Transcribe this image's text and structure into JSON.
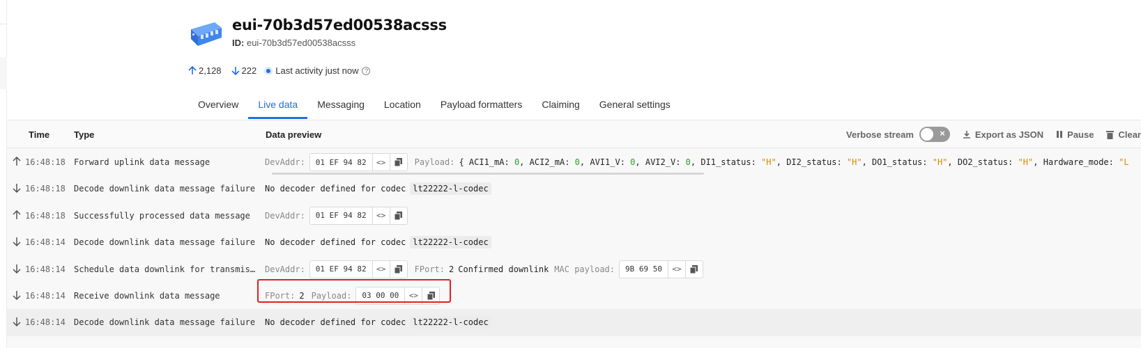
{
  "device": {
    "title": "eui-70b3d57ed00538acsss",
    "id_label": "ID:",
    "id_value": "eui-70b3d57ed00538acsss"
  },
  "stats": {
    "uplinks": "2,128",
    "downlinks": "222",
    "last_activity": "Last activity just now"
  },
  "tabs": [
    "Overview",
    "Live data",
    "Messaging",
    "Location",
    "Payload formatters",
    "Claiming",
    "General settings"
  ],
  "active_tab": "Live data",
  "table": {
    "col_time": "Time",
    "col_type": "Type",
    "col_preview": "Data preview",
    "verbose_label": "Verbose stream",
    "export_label": "Export as JSON",
    "pause_label": "Pause",
    "clear_label": "Clear"
  },
  "rows": [
    {
      "dir": "up",
      "time": "16:48:18",
      "type": "Forward uplink data message",
      "devaddr_label": "DevAddr:",
      "devaddr": "01 EF 94 82",
      "payload_label": "Payload:",
      "payload_fields": [
        {
          "k": "ACI1_mA",
          "v": "0",
          "t": "num"
        },
        {
          "k": "ACI2_mA",
          "v": "0",
          "t": "num"
        },
        {
          "k": "AVI1_V",
          "v": "0",
          "t": "num"
        },
        {
          "k": "AVI2_V",
          "v": "0",
          "t": "num"
        },
        {
          "k": "DI1_status",
          "v": "\"H\"",
          "t": "str"
        },
        {
          "k": "DI2_status",
          "v": "\"H\"",
          "t": "str"
        },
        {
          "k": "DO1_status",
          "v": "\"H\"",
          "t": "str"
        },
        {
          "k": "DO2_status",
          "v": "\"H\"",
          "t": "str"
        },
        {
          "k": "Hardware_mode",
          "v": "\"L",
          "t": "str"
        }
      ]
    },
    {
      "dir": "down",
      "time": "16:48:18",
      "type": "Decode downlink data message failure",
      "text": "No decoder defined for codec",
      "codec": "lt22222-l-codec"
    },
    {
      "dir": "up",
      "time": "16:48:18",
      "type": "Successfully processed data message",
      "devaddr_label": "DevAddr:",
      "devaddr": "01 EF 94 82"
    },
    {
      "dir": "down",
      "time": "16:48:14",
      "type": "Decode downlink data message failure",
      "text": "No decoder defined for codec",
      "codec": "lt22222-l-codec"
    },
    {
      "dir": "down",
      "time": "16:48:14",
      "type": "Schedule data downlink for transmission",
      "devaddr_label": "DevAddr:",
      "devaddr": "01 EF 94 82",
      "fport_label": "FPort:",
      "fport": "2",
      "confirmed": "Confirmed downlink",
      "mac_label": "MAC payload:",
      "mac": "9B 69 50"
    },
    {
      "dir": "down",
      "time": "16:48:14",
      "type": "Receive downlink data message",
      "fport_label": "FPort:",
      "fport": "2",
      "payload_label": "Payload:",
      "payload": "03 00 00"
    },
    {
      "dir": "down",
      "time": "16:48:14",
      "type": "Decode downlink data message failure",
      "text": "No decoder defined for codec",
      "codec": "lt22222-l-codec"
    }
  ],
  "colors": {
    "accent": "#1e6fe8",
    "highlight_box": "#e02020",
    "string_value": "#d08a00",
    "number_value": "#2a9d2a"
  }
}
